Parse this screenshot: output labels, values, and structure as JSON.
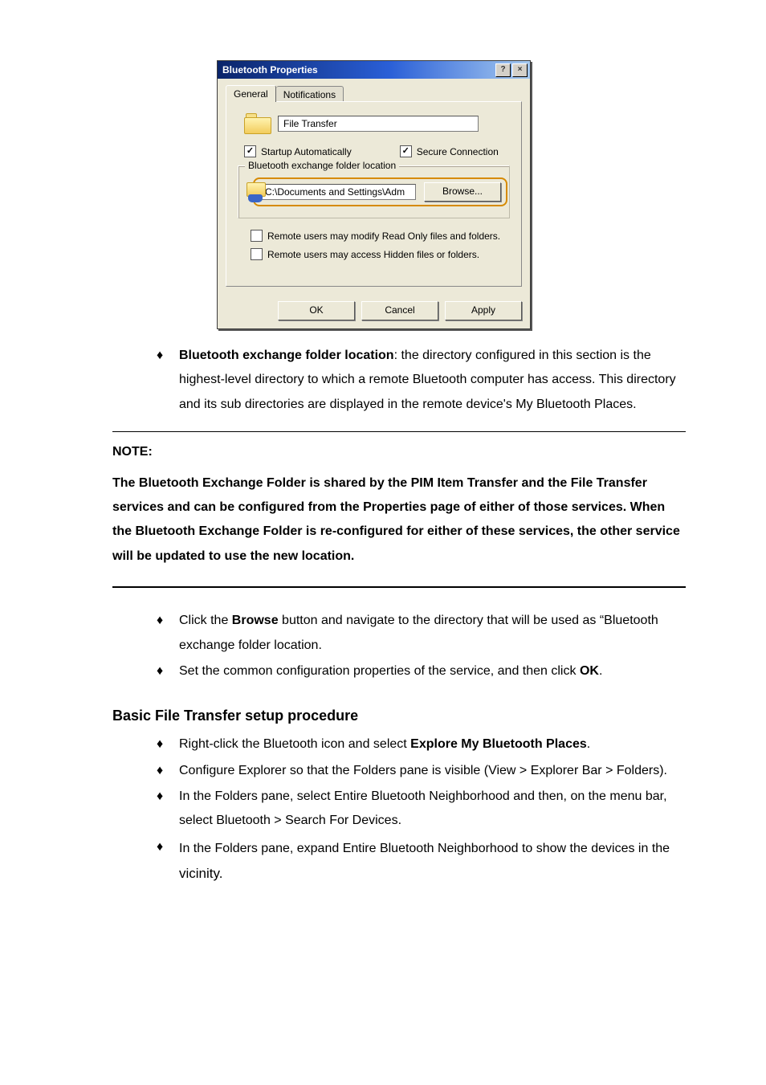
{
  "dialog": {
    "title": "Bluetooth Properties",
    "help_btn": "?",
    "close_btn": "×",
    "tabs": {
      "general": "General",
      "notifications": "Notifications"
    },
    "name_value": "File Transfer",
    "startup_label": "Startup Automatically",
    "secure_label": "Secure Connection",
    "group_legend": "Bluetooth exchange folder location",
    "path_value": "C:\\Documents and Settings\\Adm",
    "browse_label": "Browse...",
    "perm_modify": "Remote users may modify Read Only files and folders.",
    "perm_hidden": "Remote users may access Hidden files or folders.",
    "ok": "OK",
    "cancel": "Cancel",
    "apply": "Apply",
    "checkmark": "✓"
  },
  "bullets1": {
    "a_lead": "Bluetooth exchange folder location",
    "a_rest": ": the directory configured in this section is the highest-level directory to which a remote Bluetooth computer has access. This directory and its sub directories are displayed in the remote device's My Bluetooth Places."
  },
  "note": {
    "heading": "NOTE:",
    "body": "The Bluetooth Exchange Folder is shared by the PIM Item Transfer and the File Transfer services and can be configured from the Properties page of either of those services. When the Bluetooth Exchange Folder is re-configured for either of these services, the other service will be updated to use the new location."
  },
  "bullets2": {
    "a_pre": "Click the ",
    "a_bold": "Browse",
    "a_post": " button and navigate to the directory that will be used as “Bluetooth exchange folder location.",
    "b_pre": "Set the common configuration properties of the service, and then click ",
    "b_bold": "OK",
    "b_post": "."
  },
  "section2": {
    "title": "Basic File Transfer setup procedure",
    "items": {
      "a_pre": "Right-click the Bluetooth icon and select ",
      "a_bold": "Explore My Bluetooth Places",
      "a_post": ".",
      "b": "Configure Explorer so that the Folders pane is visible (View > Explorer Bar > Folders).",
      "c": "In the Folders pane, select Entire Bluetooth Neighborhood and then, on the menu bar, select Bluetooth > Search For Devices.",
      "d_pre": "In the Folders pane, expand Entire Bluetooth Neighborhood to show the devices in the",
      "d_post": " vicinity."
    }
  }
}
